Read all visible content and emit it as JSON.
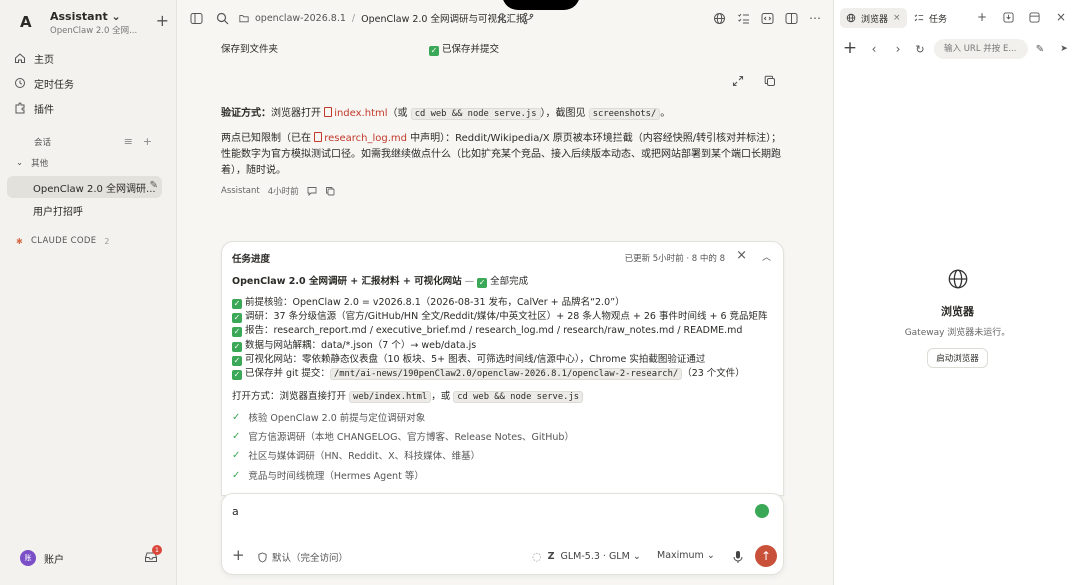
{
  "sidebar": {
    "workspace": {
      "avatar": "A",
      "title": "Assistant ⌄",
      "subtitle": "OpenClaw 2.0 全网...",
      "new_label": "+"
    },
    "nav": [
      {
        "label": "主页",
        "icon": "home-icon"
      },
      {
        "label": "定时任务",
        "icon": "clock-icon"
      },
      {
        "label": "插件",
        "icon": "puzzle-icon"
      }
    ],
    "section_label": "会话",
    "group_label": "其他",
    "conversations": [
      {
        "label": "OpenClaw 2.0 全网调研..."
      },
      {
        "label": "用户打招呼"
      }
    ],
    "claude_code": {
      "label": "CLAUDE CODE",
      "count": "2"
    },
    "account": {
      "avatar": "账",
      "label": "账户",
      "badge": "1"
    }
  },
  "header": {
    "path": "openclaw-2026.8.1",
    "separator": "/",
    "title": "OpenClaw 2.0 全网调研与可视化汇报"
  },
  "message": {
    "save_label": "保存到文件夹",
    "save_value": "已保存并提交",
    "verify": {
      "lead": "验证方式：",
      "t1": "浏览器打开 ",
      "file": "index.html",
      "t2": "（或 ",
      "cmd": "cd web && node serve.js",
      "t3": "），截图见 ",
      "dir": "screenshots/",
      "t4": "。"
    },
    "limits": {
      "t1": "两点已知限制（已在 ",
      "file": "research_log.md",
      "t2": " 中声明）：Reddit/Wikipedia/X 原页被本环境拦截（内容经快照/转引核对并标注）；性能数字为官方模拟测试口径。如需我继续做点什么（比如扩充某个竞品、接入后续版本动态、或把网站部署到某个端口长期跑着），随时说。"
    },
    "author": "Assistant",
    "time": "4小时前"
  },
  "progress": {
    "title": "任务进度",
    "updated": "已更新 5小时前 · 8 中的 8",
    "headline": "OpenClaw 2.0 全网调研 + 汇报材料 + 可视化网站",
    "headline_dash": " — ",
    "headline_status": "全部完成",
    "items": [
      "前提核验：OpenClaw 2.0 = v2026.8.1（2026-08-31 发布，CalVer + 品牌名“2.0”）",
      "调研：37 条分级信源（官方/GitHub/HN 全文/Reddit/媒体/中英文社区）+ 28 条人物观点 + 26 事件时间线 + 6 竞品矩阵",
      "报告：research_report.md / executive_brief.md / research_log.md / research/raw_notes.md / README.md",
      "数据与网站解耦：data/*.json（7 个）→ web/data.js",
      "可视化网站：零依赖静态仪表盘（10 板块、5+ 图表、可筛选时间线/信源中心），Chrome 实拍截图验证通过"
    ],
    "git_line": {
      "label": "已保存并 git 提交：",
      "path": "/mnt/ai-news/190penClaw2.0/openclaw-2026.8.1/openclaw-2-research/",
      "count": "（23 个文件）"
    },
    "open_line": {
      "label": "打开方式：浏览器直接打开 ",
      "file": "web/index.html",
      "or": "，或 ",
      "cmd": "cd web && node serve.js"
    },
    "tasks": [
      "核验 OpenClaw 2.0 前提与定位调研对象",
      "官方信源调研（本地 CHANGELOG、官方博客、Release Notes、GitHub）",
      "社区与媒体调研（HN、Reddit、X、科技媒体、维基）",
      "竞品与时间线梳理（Hermes Agent 等）"
    ]
  },
  "composer": {
    "text": "a",
    "access": "默认（完全访问）",
    "model": "GLM-5.3 · GLM ⌄",
    "mode": "Maximum ⌄"
  },
  "right_panel": {
    "tabs": [
      {
        "label": "浏览器"
      },
      {
        "label": "任务"
      }
    ],
    "url_placeholder": "输入 URL 并按 E...",
    "empty_title": "浏览器",
    "empty_sub": "Gateway 浏览器未运行。",
    "start_button": "启动浏览器"
  },
  "colors": {
    "accent_red": "#c9513a",
    "success_green": "#3aa856",
    "link_red": "#c0392b"
  }
}
